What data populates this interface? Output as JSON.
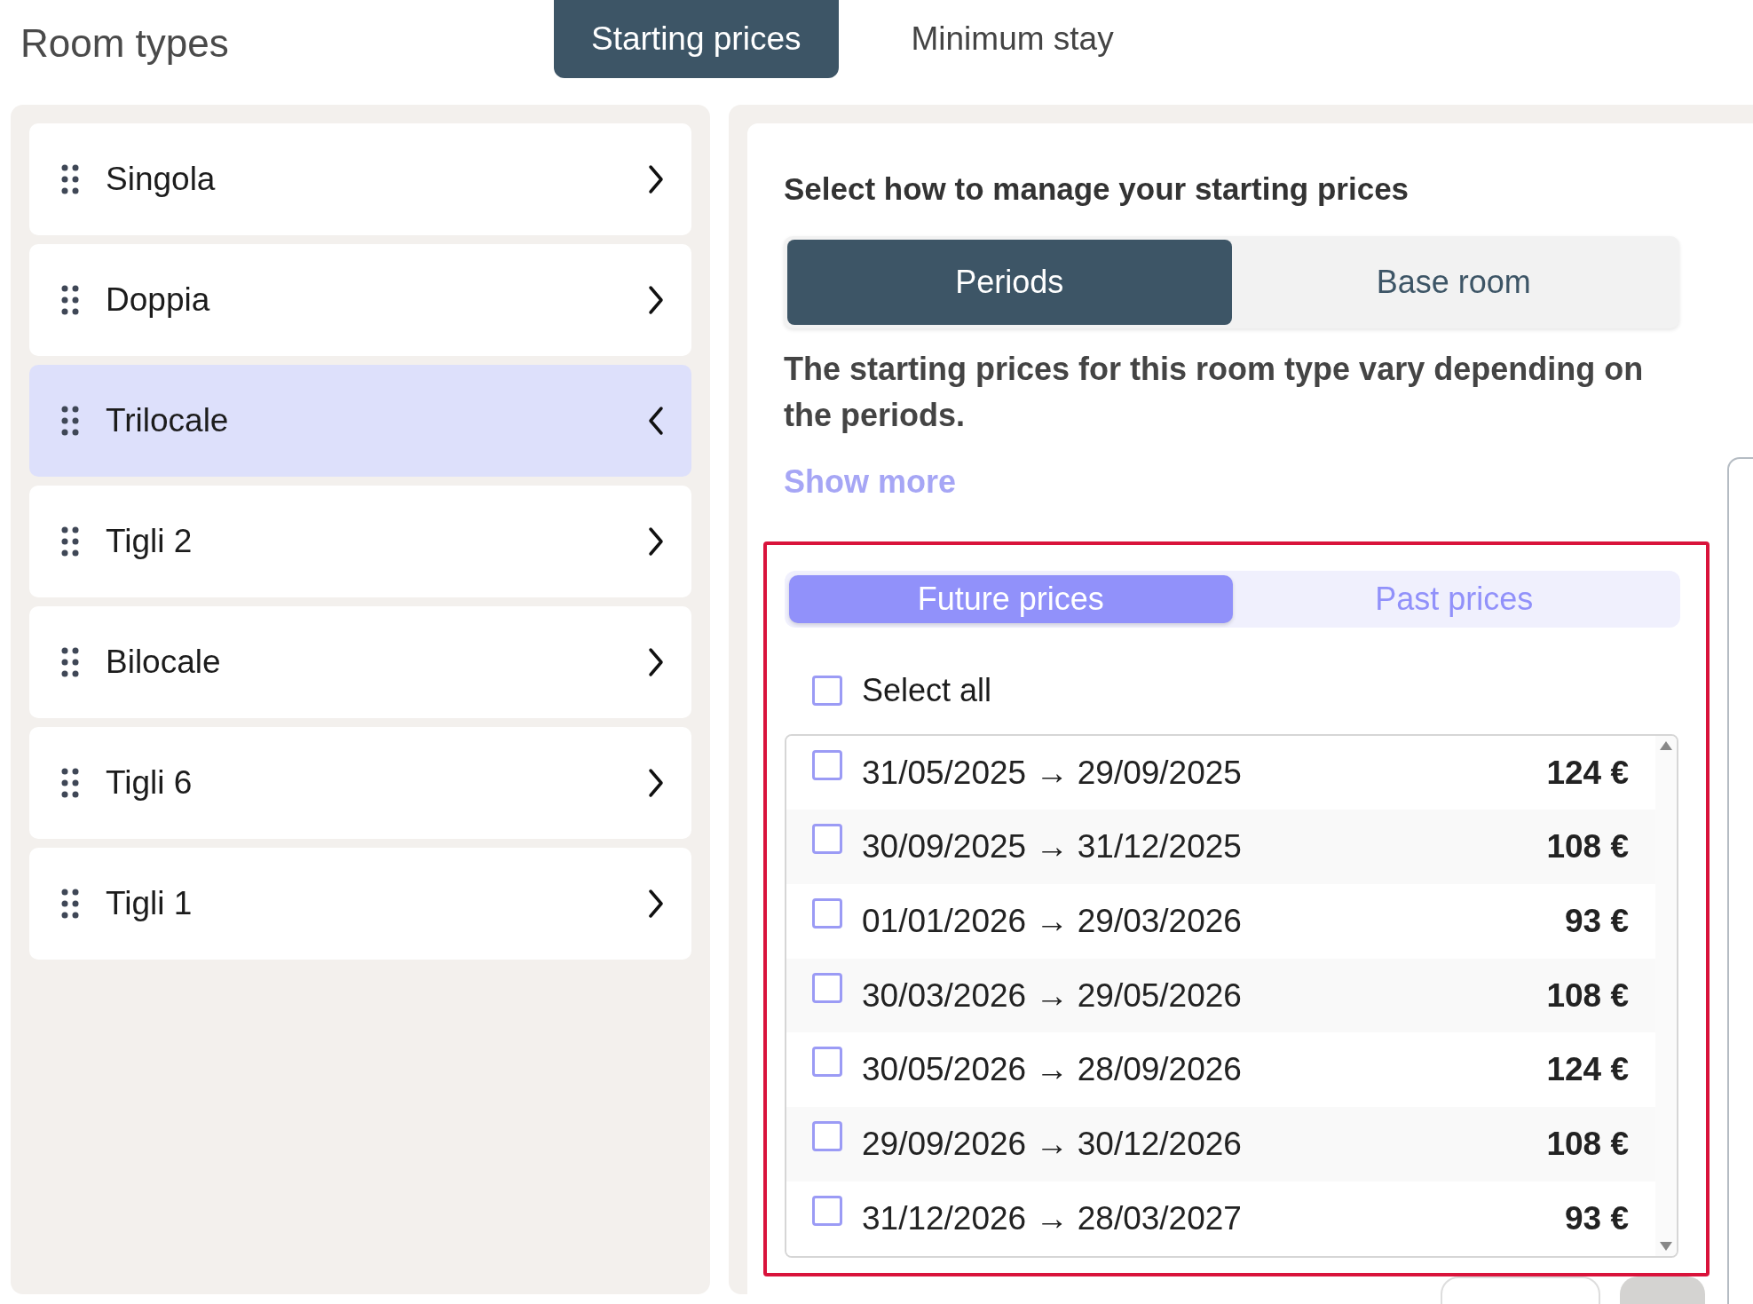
{
  "header": {
    "title": "Room types"
  },
  "tabs": [
    {
      "label": "Starting prices",
      "selected": true
    },
    {
      "label": "Minimum stay",
      "selected": false
    }
  ],
  "rooms": [
    {
      "name": "Singola",
      "expanded": false
    },
    {
      "name": "Doppia",
      "expanded": false
    },
    {
      "name": "Trilocale",
      "expanded": true
    },
    {
      "name": "Tigli 2",
      "expanded": false
    },
    {
      "name": "Bilocale",
      "expanded": false
    },
    {
      "name": "Tigli 6",
      "expanded": false
    },
    {
      "name": "Tigli 1",
      "expanded": false
    }
  ],
  "settings": {
    "heading": "Select how to manage your starting prices",
    "modes": [
      {
        "label": "Periods",
        "selected": true
      },
      {
        "label": "Base room",
        "selected": false
      }
    ],
    "description": "The starting prices for this room type vary depending on the periods.",
    "show_more": "Show more"
  },
  "prices": {
    "views": [
      {
        "label": "Future prices",
        "selected": true
      },
      {
        "label": "Past prices",
        "selected": false
      }
    ],
    "select_all": {
      "label": "Select all",
      "checked": false
    },
    "periods": [
      {
        "range": "31/05/2025 → 29/09/2025",
        "price": "124 €",
        "checked": false
      },
      {
        "range": "30/09/2025 → 31/12/2025",
        "price": "108 €",
        "checked": false
      },
      {
        "range": "01/01/2026 → 29/03/2026",
        "price": "93 €",
        "checked": false
      },
      {
        "range": "30/03/2026 → 29/05/2026",
        "price": "108 €",
        "checked": false
      },
      {
        "range": "30/05/2026 → 28/09/2026",
        "price": "124 €",
        "checked": false
      },
      {
        "range": "29/09/2026 → 30/12/2026",
        "price": "108 €",
        "checked": false
      },
      {
        "range": "31/12/2026 → 28/03/2027",
        "price": "93 €",
        "checked": false
      }
    ]
  }
}
